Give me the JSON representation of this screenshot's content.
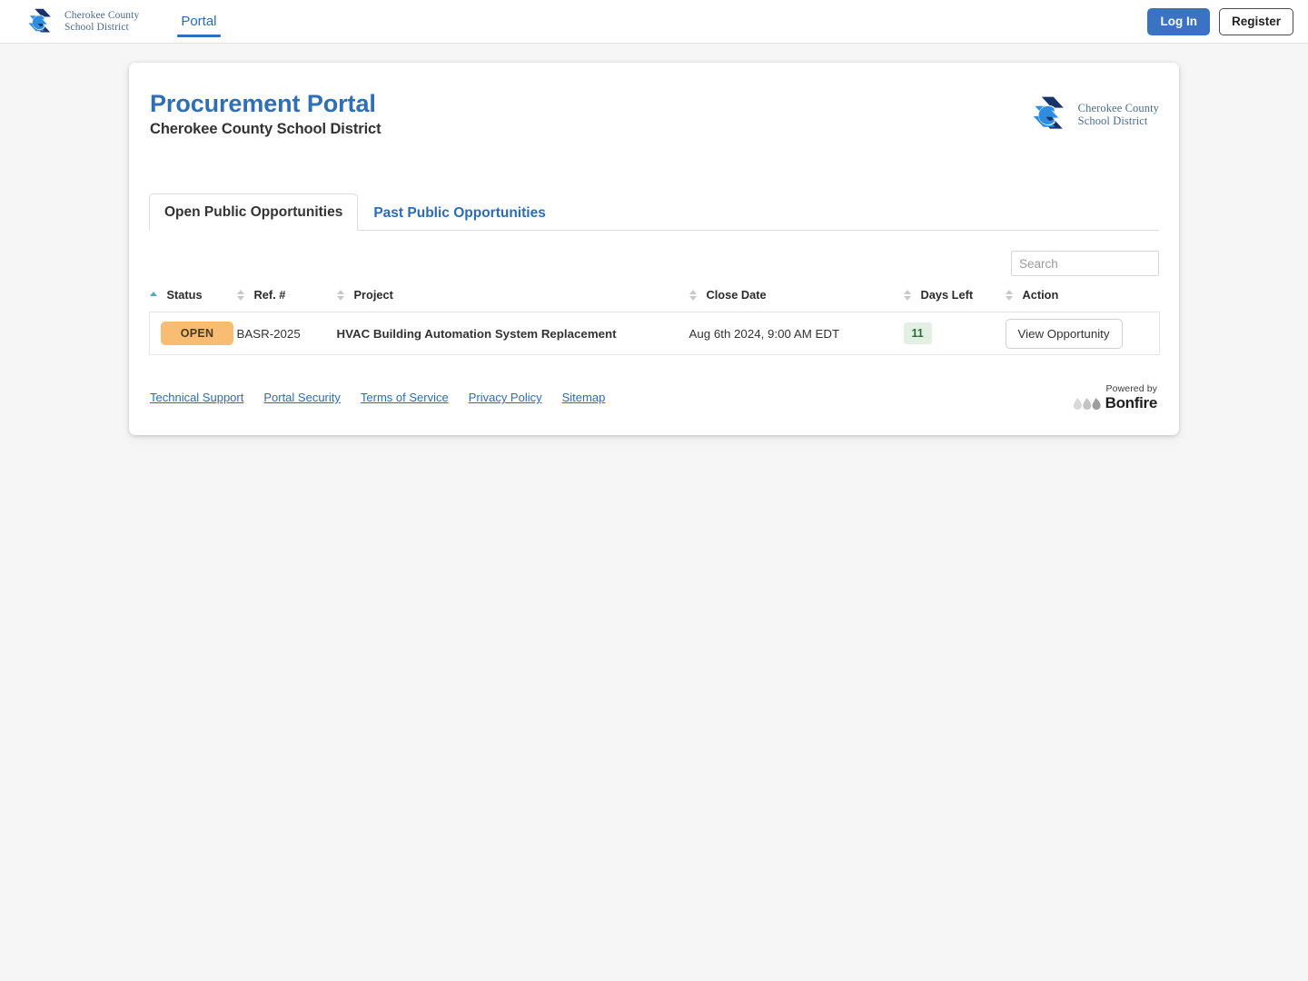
{
  "navbar": {
    "brand": {
      "line1": "Cherokee County",
      "line2": "School District",
      "logo_icon": "cherokee-c-logo-icon"
    },
    "links": [
      {
        "label": "Portal",
        "active": true
      }
    ],
    "login_label": "Log In",
    "register_label": "Register"
  },
  "card": {
    "title": "Procurement Portal",
    "subtitle": "Cherokee County School District",
    "logo": {
      "line1": "Cherokee County",
      "line2": "School District"
    },
    "tabs": [
      {
        "label": "Open Public Opportunities",
        "active": true
      },
      {
        "label": "Past Public Opportunities",
        "active": false
      }
    ],
    "search": {
      "value": "",
      "placeholder": "Search"
    },
    "table": {
      "columns": [
        {
          "label": "Status",
          "sort": "asc"
        },
        {
          "label": "Ref. #",
          "sort": "none"
        },
        {
          "label": "Project",
          "sort": "none"
        },
        {
          "label": "Close Date",
          "sort": "none"
        },
        {
          "label": "Days Left",
          "sort": "none"
        },
        {
          "label": "Action",
          "sort": "none"
        }
      ],
      "rows": [
        {
          "status": "OPEN",
          "ref": "BASR-2025",
          "project": "HVAC Building Automation System Replacement",
          "close_date": "Aug 6th 2024, 9:00 AM EDT",
          "days_left": "11",
          "action_label": "View Opportunity"
        }
      ]
    },
    "footer": {
      "links": [
        "Technical Support",
        "Portal Security",
        "Terms of Service",
        "Privacy Policy",
        "Sitemap"
      ],
      "powered_by_label": "Powered by",
      "powered_by_brand": "Bonfire"
    }
  },
  "colors": {
    "brand_blue": "#2f6fb5",
    "login_blue": "#3a72c4",
    "status_open_bg": "#f8bd72",
    "days_left_bg": "#e2f0e3",
    "days_left_text": "#2d6b34",
    "page_bg": "#f6f6f6"
  }
}
